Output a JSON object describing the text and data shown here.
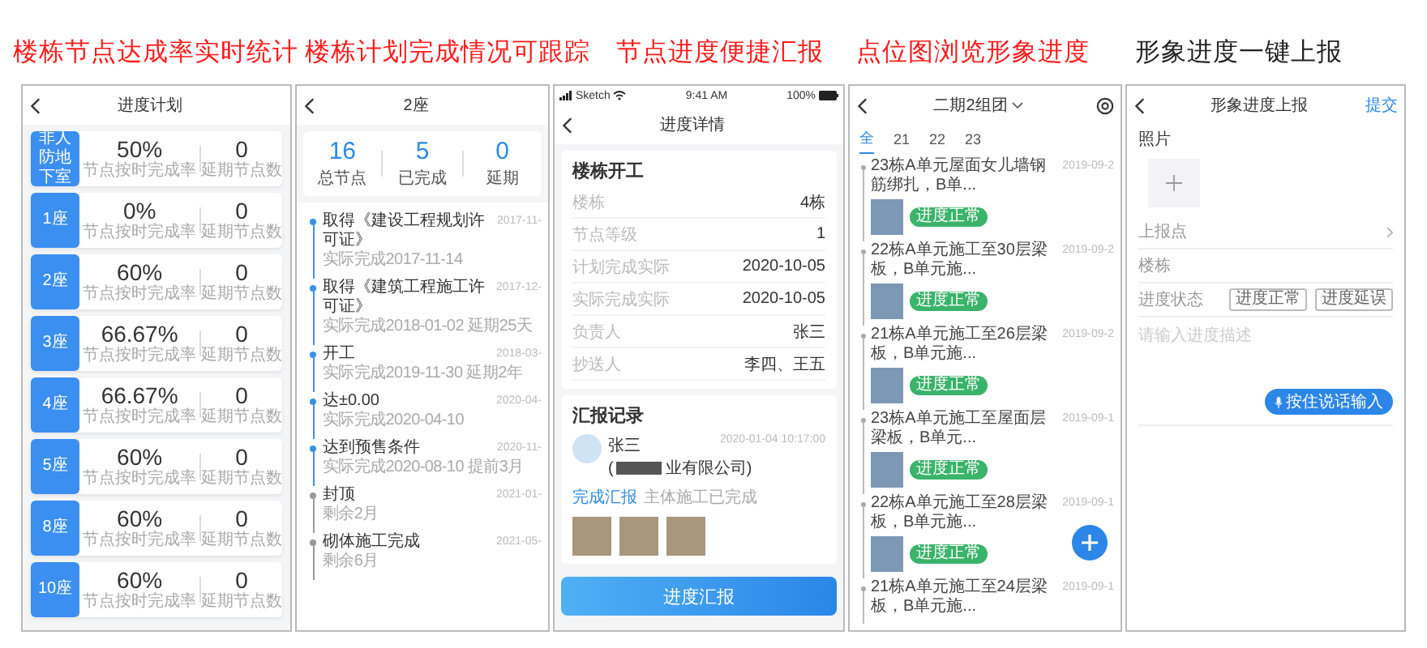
{
  "headings": [
    {
      "text": "楼栋节点达成率实时统计",
      "color": "#ff1a1a"
    },
    {
      "text": "楼栋计划完成情况可跟踪",
      "color": "#ff1a1a"
    },
    {
      "text": "节点进度便捷汇报",
      "color": "#ff1a1a"
    },
    {
      "text": "点位图浏览形象进度",
      "color": "#ff1a1a"
    },
    {
      "text": "形象进度一键上报",
      "color": "#222222"
    }
  ],
  "plan": {
    "title": "进度计划",
    "rows": [
      {
        "label": "非人防地下室",
        "rate": "50%",
        "rate_label": "节点按时完成率",
        "delayed": "0",
        "delayed_label": "延期节点数"
      },
      {
        "label": "1座",
        "rate": "0%",
        "rate_label": "节点按时完成率",
        "delayed": "0",
        "delayed_label": "延期节点数"
      },
      {
        "label": "2座",
        "rate": "60%",
        "rate_label": "节点按时完成率",
        "delayed": "0",
        "delayed_label": "延期节点数"
      },
      {
        "label": "3座",
        "rate": "66.67%",
        "rate_label": "节点按时完成率",
        "delayed": "0",
        "delayed_label": "延期节点数"
      },
      {
        "label": "4座",
        "rate": "66.67%",
        "rate_label": "节点按时完成率",
        "delayed": "0",
        "delayed_label": "延期节点数"
      },
      {
        "label": "5座",
        "rate": "60%",
        "rate_label": "节点按时完成率",
        "delayed": "0",
        "delayed_label": "延期节点数"
      },
      {
        "label": "8座",
        "rate": "60%",
        "rate_label": "节点按时完成率",
        "delayed": "0",
        "delayed_label": "延期节点数"
      },
      {
        "label": "10座",
        "rate": "60%",
        "rate_label": "节点按时完成率",
        "delayed": "0",
        "delayed_label": "延期节点数"
      }
    ]
  },
  "building": {
    "title": "2座",
    "stats": [
      {
        "value": "16",
        "label": "总节点"
      },
      {
        "value": "5",
        "label": "已完成"
      },
      {
        "value": "0",
        "label": "延期"
      }
    ],
    "nodes": [
      {
        "title": "取得《建设工程规划许可证》",
        "date": "2017-11-",
        "note": "实际完成2017-11-14",
        "done": true
      },
      {
        "title": "取得《建筑工程施工许可证》",
        "date": "2017-12-",
        "note": "实际完成2018-01-02 延期25天",
        "done": true
      },
      {
        "title": "开工",
        "date": "2018-03-",
        "note": "实际完成2019-11-30 延期2年",
        "done": true
      },
      {
        "title": "达±0.00",
        "date": "2020-04-",
        "note": "实际完成2020-04-10",
        "done": true
      },
      {
        "title": "达到预售条件",
        "date": "2020-11-",
        "note": "实际完成2020-08-10 提前3月",
        "done": true
      },
      {
        "title": "封顶",
        "date": "2021-01-",
        "note": "剩余2月",
        "done": false
      },
      {
        "title": "砌体施工完成",
        "date": "2021-05-",
        "note": "剩余6月",
        "done": false
      }
    ]
  },
  "detail": {
    "status_bar": {
      "carrier": "Sketch",
      "time": "9:41 AM",
      "battery": "100%"
    },
    "title": "进度详情",
    "card_title": "楼栋开工",
    "fields": [
      {
        "label": "楼栋",
        "value": "4栋"
      },
      {
        "label": "节点等级",
        "value": "1"
      },
      {
        "label": "计划完成实际",
        "value": "2020-10-05"
      },
      {
        "label": "实际完成实际",
        "value": "2020-10-05"
      },
      {
        "label": "负责人",
        "value": "张三"
      },
      {
        "label": "抄送人",
        "value": "李四、王五"
      }
    ],
    "record": {
      "heading": "汇报记录",
      "name": "张三",
      "company_start": "(",
      "company_end": "业有限公司)",
      "time": "2020-01-04 10:17:00",
      "link": "完成汇报",
      "text": "主体施工已完成"
    },
    "button": "进度汇报"
  },
  "feed": {
    "title": "二期2组团",
    "tabs": [
      {
        "label": "全",
        "selected": true
      },
      {
        "label": "21",
        "selected": false
      },
      {
        "label": "22",
        "selected": false
      },
      {
        "label": "23",
        "selected": false
      }
    ],
    "items": [
      {
        "kind": "full",
        "title": "23栋A单元屋面女儿墙钢筋绑扎，B单...",
        "date": "2019-09-2",
        "tag": "进度正常"
      },
      {
        "kind": "full",
        "title": "22栋A单元施工至30层梁板，B单元施...",
        "date": "2019-09-2",
        "tag": "进度正常"
      },
      {
        "kind": "full",
        "title": "21栋A单元施工至26层梁板，B单元施...",
        "date": "2019-09-2",
        "tag": "进度正常"
      },
      {
        "kind": "full",
        "title": "23栋A单元施工至屋面层梁板，B单元...",
        "date": "2019-09-1",
        "tag": "进度正常"
      },
      {
        "kind": "full",
        "title": "22栋A单元施工至28层梁板，B单元施...",
        "date": "2019-09-1",
        "tag": "进度正常"
      },
      {
        "kind": "brief",
        "title": "21栋A单元施工至24层梁板，B单元施...",
        "date": "2019-09-1"
      }
    ]
  },
  "report": {
    "title": "形象进度上报",
    "submit": "提交",
    "photo_label": "照片",
    "rows": [
      {
        "kind": "link",
        "label": "上报点"
      },
      {
        "kind": "plain",
        "label": "楼栋"
      },
      {
        "kind": "choice",
        "label": "进度状态",
        "options": [
          "进度正常",
          "进度延误"
        ]
      }
    ],
    "placeholder": "请输入进度描述",
    "voice": "按住说话输入"
  }
}
